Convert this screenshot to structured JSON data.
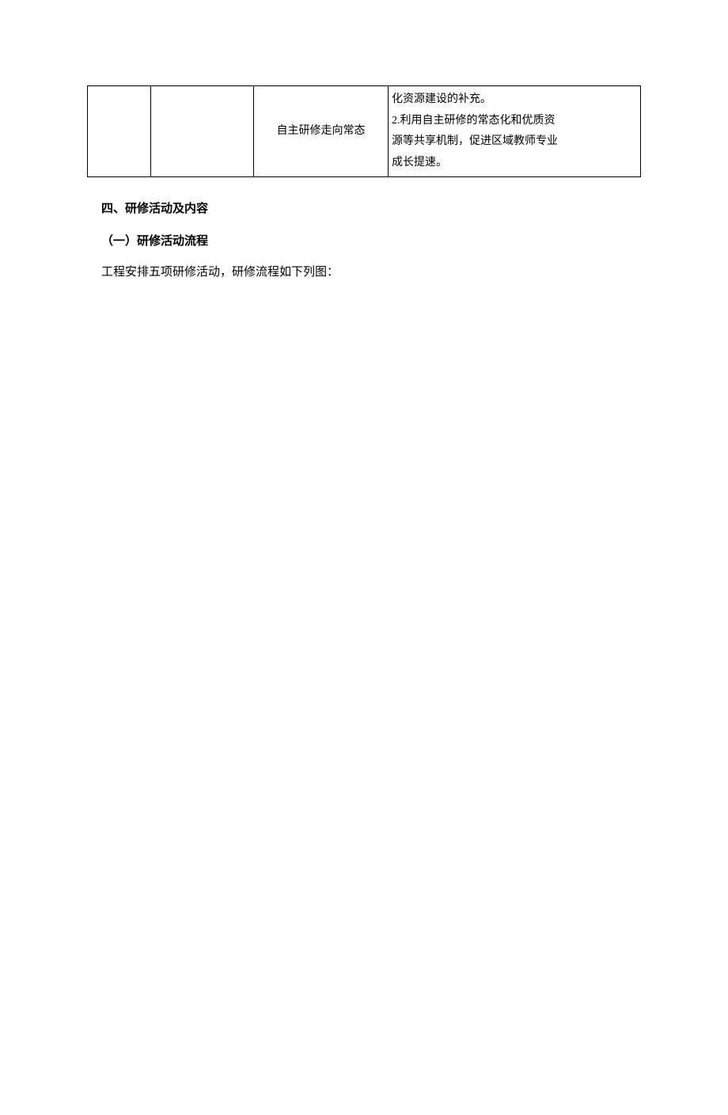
{
  "table": {
    "col3_text": "自主研修走向常态",
    "col4_lines": [
      "化资源建设的补充。",
      "2.利用自主研修的常态化和优质资",
      "源等共享机制，促进区域教师专业",
      "成长提速。"
    ]
  },
  "headings": {
    "section4": "四、研修活动及内容",
    "subsection1": "（一）研修活动流程"
  },
  "paragraph": "工程安排五项研修活动，研修流程如下列图："
}
